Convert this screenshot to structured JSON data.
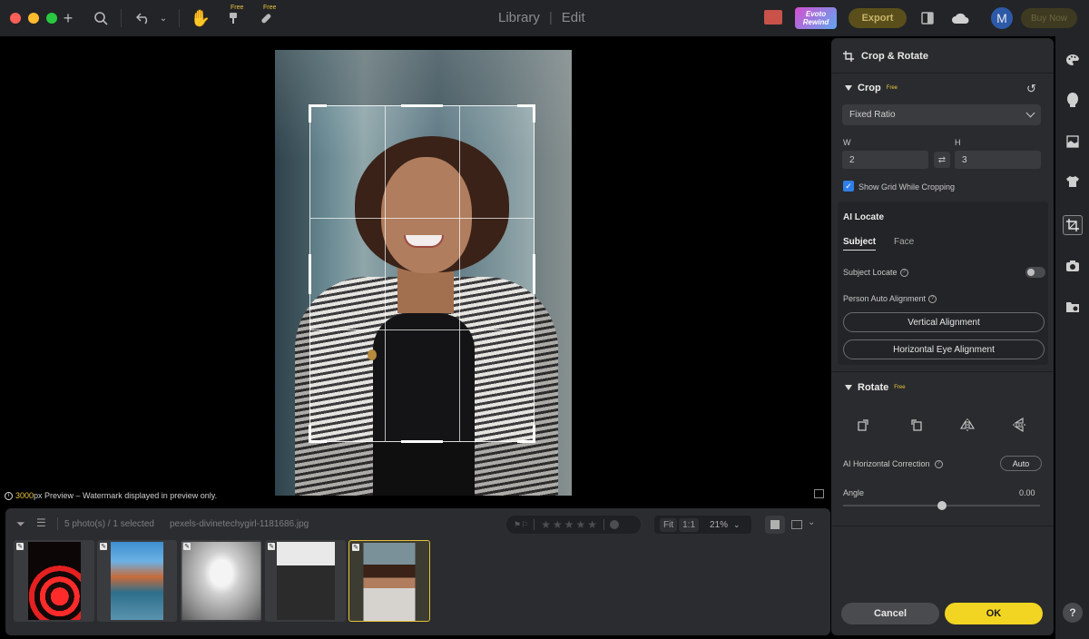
{
  "titlebar": {
    "free_tag_1": "Free",
    "free_tag_2": "Free",
    "mode_library": "Library",
    "mode_edit": "Edit",
    "badge_line1": "Evoto",
    "badge_line2": "Rewind",
    "export_label": "Export",
    "avatar_letter": "M",
    "buy_label": "Buy Now",
    "icons": [
      "plus-icon",
      "search-icon",
      "undo-icon",
      "hand-icon",
      "brush-icon",
      "bandage-icon",
      "gift-icon",
      "split-view-icon",
      "cloud-icon"
    ]
  },
  "canvas": {
    "preview_size": "3000",
    "preview_unit": "px Preview – Watermark displayed in preview only."
  },
  "filmstrip": {
    "count_text": "5 photo(s) / 1 selected",
    "filename": "pexels-divinetechygirl-1181686.jpg",
    "fit_label": "Fit",
    "ratio_label": "1:1",
    "zoom": "21%",
    "rating_stars": 5,
    "selected_index": 4,
    "thumbnails": [
      "spiral staircase",
      "waterfront buildings",
      "corridor",
      "man in suit",
      "woman portrait"
    ]
  },
  "panel": {
    "title": "Crop & Rotate",
    "crop": {
      "title": "Crop",
      "badge": "Free",
      "ratio_select": "Fixed Ratio",
      "w_label": "W",
      "h_label": "H",
      "w_value": "2",
      "h_value": "3",
      "show_grid_label": "Show Grid While Cropping",
      "show_grid_checked": true
    },
    "ai_locate": {
      "title": "AI Locate",
      "tab_subject": "Subject",
      "tab_face": "Face",
      "subject_locate_label": "Subject Locate",
      "subject_locate_on": false,
      "person_alignment_label": "Person Auto Alignment",
      "vertical_btn": "Vertical Alignment",
      "horizontal_btn": "Horizontal Eye Alignment"
    },
    "rotate": {
      "title": "Rotate",
      "badge": "Free",
      "ai_horizontal_label": "AI Horizontal Correction",
      "auto_label": "Auto",
      "angle_label": "Angle",
      "angle_value": "0.00",
      "angle_slider_fraction": 0.5
    },
    "cancel_label": "Cancel",
    "ok_label": "OK"
  },
  "sidebar": {
    "icons": [
      "palette-icon",
      "face-icon",
      "background-icon",
      "clothing-icon",
      "crop-icon",
      "camera-icon",
      "folder-icon"
    ],
    "active": "crop-icon",
    "help_label": "?"
  },
  "colors": {
    "accent_yellow": "#f2d522",
    "checkbox_blue": "#2f7fe8",
    "panel_bg": "#2a2b2e"
  }
}
